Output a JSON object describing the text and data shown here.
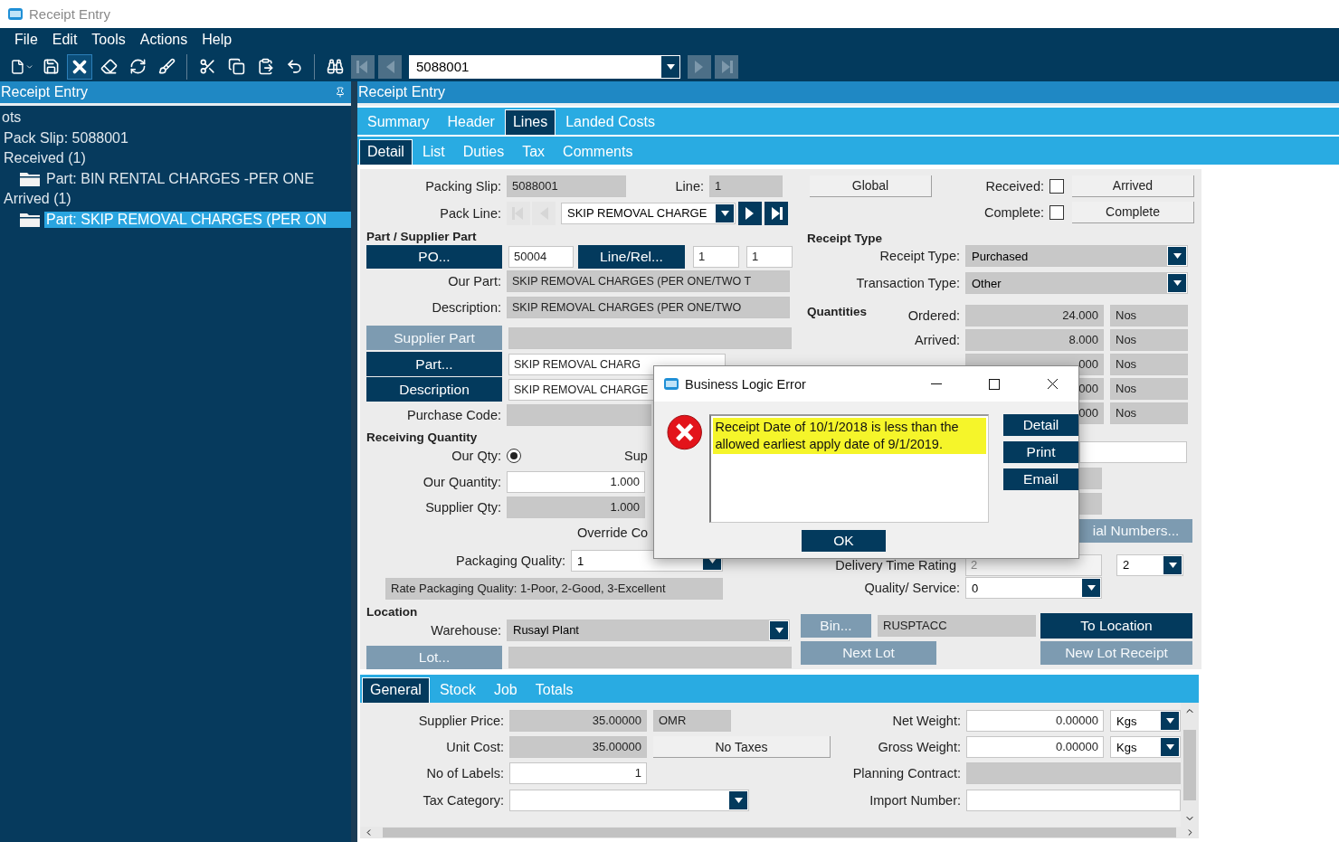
{
  "window": {
    "title": "Receipt Entry"
  },
  "menu": [
    "File",
    "Edit",
    "Tools",
    "Actions",
    "Help"
  ],
  "toolbar": {
    "record": "5088001"
  },
  "tree": {
    "title": "Receipt Entry",
    "items": [
      {
        "label": "ots",
        "kind": "text",
        "selected": false,
        "children": [
          {
            "label": "Pack Slip: 5088001",
            "kind": "text",
            "selected": false
          },
          {
            "label": "Received (1)",
            "kind": "text",
            "selected": false,
            "children": [
              {
                "label": "Part: BIN RENTAL CHARGES -PER ONE",
                "kind": "folder",
                "selected": false
              }
            ]
          },
          {
            "label": "Arrived (1)",
            "kind": "text",
            "selected": false,
            "children": [
              {
                "label": "Part: SKIP REMOVAL CHARGES (PER ON",
                "kind": "folder",
                "selected": true
              }
            ]
          }
        ]
      }
    ]
  },
  "panel_title": "Receipt Entry",
  "tabs": [
    {
      "label": "Summary",
      "selected": false
    },
    {
      "label": "Header",
      "selected": false
    },
    {
      "label": "Lines",
      "selected": true
    },
    {
      "label": "Landed Costs",
      "selected": false
    }
  ],
  "subtabs": [
    {
      "label": "Detail",
      "selected": true
    },
    {
      "label": "List",
      "selected": false
    },
    {
      "label": "Duties",
      "selected": false
    },
    {
      "label": "Tax",
      "selected": false
    },
    {
      "label": "Comments",
      "selected": false
    }
  ],
  "packing_slip": {
    "label": "Packing Slip:",
    "value": "5088001"
  },
  "line": {
    "label": "Line:",
    "value": "1"
  },
  "pack_line": {
    "label": "Pack Line:",
    "value": "SKIP REMOVAL CHARGE"
  },
  "part_section": {
    "title": "Part / Supplier Part",
    "po_button": {
      "label": "PO...",
      "disabled": false
    },
    "po": "50004",
    "line_rel_button": {
      "label": "Line/Rel...",
      "disabled": false
    },
    "line_value": "1",
    "release_value": "1",
    "our_part": {
      "label": "Our Part:",
      "value": "SKIP REMOVAL CHARGES (PER ONE/TWO T"
    },
    "description": {
      "label": "Description:",
      "value": "SKIP REMOVAL CHARGES (PER ONE/TWO"
    },
    "supplier_part_button": {
      "label": "Supplier Part",
      "disabled": true
    },
    "part_button": {
      "label": "Part...",
      "disabled": false
    },
    "part_value": "SKIP REMOVAL CHARG",
    "description_button": {
      "label": "Description",
      "disabled": false
    },
    "description_value": "SKIP REMOVAL CHARGE",
    "purchase_code": {
      "label": "Purchase Code:"
    }
  },
  "receiving": {
    "title": "Receiving Quantity",
    "our_qty": {
      "label": "Our Qty:",
      "selected": true
    },
    "supplier_qty_label": "Sup",
    "our_quantity": {
      "label": "Our Quantity:",
      "value": "1.000"
    },
    "supplier_quantity": {
      "label": "Supplier Qty:",
      "value": "1.000"
    },
    "override_label": "Override Co",
    "packaging_quality": {
      "label": "Packaging Quality:",
      "value": "1"
    },
    "rate_note": "Rate Packaging Quality: 1-Poor, 2-Good, 3-Excellent"
  },
  "location": {
    "title": "Location",
    "warehouse": {
      "label": "Warehouse:",
      "value": "Rusayl Plant"
    },
    "lot_button": {
      "label": "Lot...",
      "disabled": true
    },
    "bin_button": {
      "label": "Bin...",
      "disabled": true
    },
    "bin": "RUSPTACC",
    "to_location_button": {
      "label": "To Location",
      "disabled": false
    },
    "next_lot_button": {
      "label": "Next Lot",
      "disabled": true
    },
    "new_lot_receipt_button": {
      "label": "New Lot Receipt",
      "disabled": true
    }
  },
  "status": {
    "global_button": "Global",
    "received": {
      "label": "Received:",
      "checked": false
    },
    "arrived_button": "Arrived",
    "complete": {
      "label": "Complete:",
      "checked": false
    },
    "complete_button": "Complete"
  },
  "receipt_type": {
    "title": "Receipt Type",
    "receipt_type": {
      "label": "Receipt Type:",
      "value": "Purchased"
    },
    "transaction_type": {
      "label": "Transaction Type:",
      "value": "Other"
    }
  },
  "quantities": {
    "title": "Quantities",
    "rows": [
      {
        "label": "Ordered:",
        "value": "24.000",
        "uom": "Nos"
      },
      {
        "label": "Arrived:",
        "value": "8.000",
        "uom": "Nos"
      },
      {
        "value": "000",
        "uom": "Nos"
      },
      {
        "value": "000",
        "uom": "Nos"
      },
      {
        "value": "000",
        "uom": "Nos"
      }
    ]
  },
  "serial_button": {
    "label": "ial Numbers...",
    "disabled": true
  },
  "delivery_time_rating": {
    "label": "Delivery Time Rating",
    "value": "2",
    "disabled": true,
    "rating": "2"
  },
  "quality_service": {
    "label": "Quality/ Service:",
    "value": "0"
  },
  "bottom_tabs": [
    {
      "label": "General",
      "selected": true
    },
    {
      "label": "Stock",
      "selected": false
    },
    {
      "label": "Job",
      "selected": false
    },
    {
      "label": "Totals",
      "selected": false
    }
  ],
  "general": {
    "supplier_price": {
      "label": "Supplier Price:",
      "value": "35.00000",
      "currency": "OMR"
    },
    "unit_cost": {
      "label": "Unit Cost:",
      "value": "35.00000"
    },
    "no_taxes_button": "No Taxes",
    "labels": {
      "label": "No of Labels:",
      "value": "1"
    },
    "tax_category": {
      "label": "Tax Category:"
    },
    "net_weight": {
      "label": "Net Weight:",
      "value": "0.00000",
      "uom": "Kgs"
    },
    "gross_weight": {
      "label": "Gross Weight:",
      "value": "0.00000",
      "uom": "Kgs"
    },
    "planning_contract": {
      "label": "Planning Contract:"
    },
    "import_number": {
      "label": "Import Number:"
    }
  },
  "dialog": {
    "title": "Business Logic Error",
    "message": "Receipt Date of 10/1/2018 is less than the allowed earliest apply date of 9/1/2019.",
    "buttons": [
      "Detail",
      "Print",
      "Email"
    ],
    "ok": "OK"
  }
}
